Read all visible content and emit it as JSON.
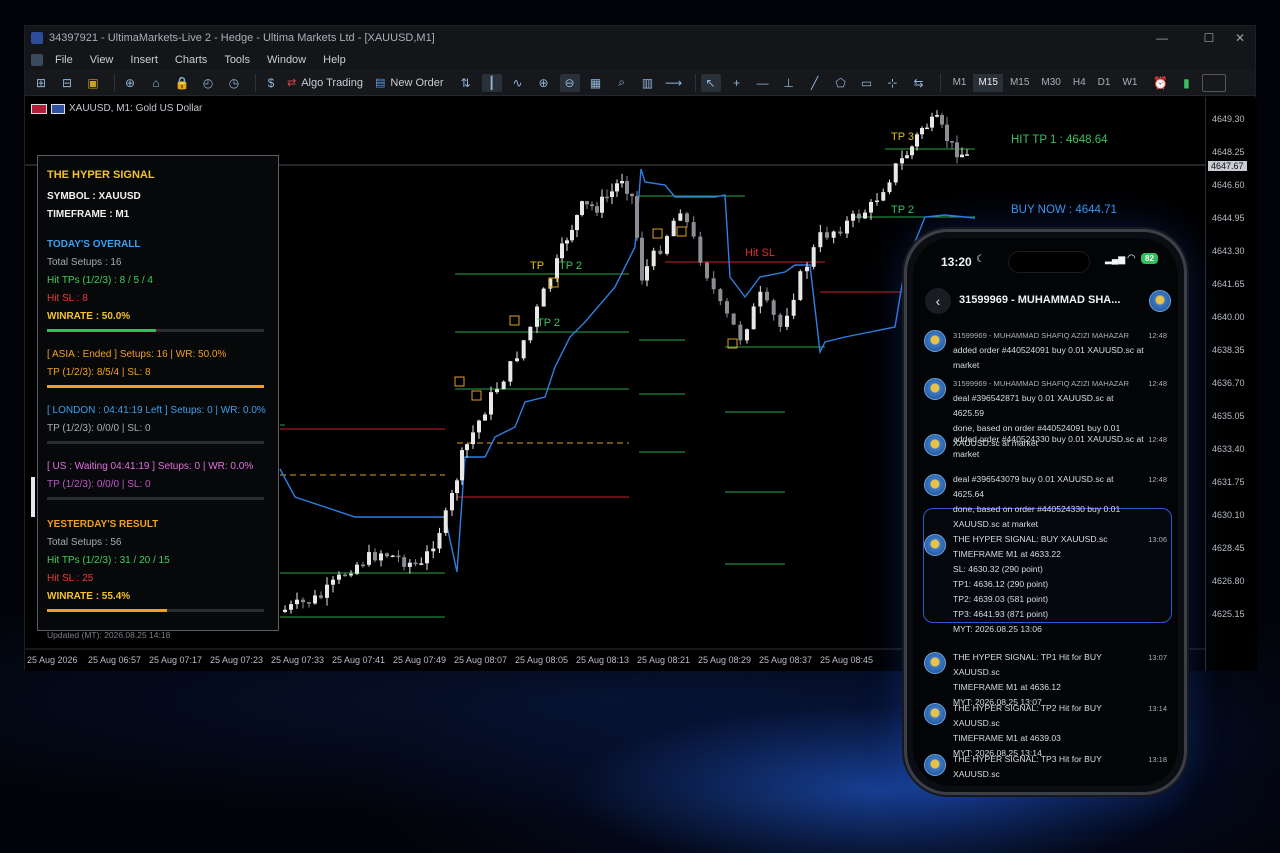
{
  "window": {
    "title": "34397921 - UltimaMarkets-Live 2 - Hedge - Ultima Markets Ltd - [XAUUSD,M1]",
    "controls": [
      "—",
      "☐",
      "✕"
    ]
  },
  "menu": [
    "File",
    "View",
    "Insert",
    "Charts",
    "Tools",
    "Window",
    "Help"
  ],
  "toolbar": {
    "algo_trading": "Algo Trading",
    "new_order": "New Order",
    "timeframes": [
      "M1",
      "M15",
      "M15",
      "M30",
      "H4",
      "D1",
      "W1"
    ],
    "selected_timeframe": "M15"
  },
  "chart": {
    "symbol_label": "XAUUSD, M1: Gold US Dollar",
    "price_ticks": [
      "4649.30",
      "4648.25",
      "4646.60",
      "4644.95",
      "4643.30",
      "4641.65",
      "4640.00",
      "4638.35",
      "4636.70",
      "4635.05",
      "4633.40",
      "4631.75",
      "4630.10",
      "4628.45",
      "4626.80",
      "4625.15"
    ],
    "current_price": "4647.67",
    "time_ticks": [
      "25 Aug 2026",
      "25 Aug 06:57",
      "25 Aug 07:17",
      "25 Aug 07:23",
      "25 Aug 07:33",
      "25 Aug 07:41",
      "25 Aug 07:49",
      "25 Aug 08:07",
      "25 Aug 08:05",
      "25 Aug 08:13",
      "25 Aug 08:21",
      "25 Aug 08:29",
      "25 Aug 08:37",
      "25 Aug 08:45"
    ],
    "labels": {
      "tp3": "TP 3",
      "tp2_a": "TP 2",
      "tp2_b": "TP 2",
      "tp2_c": "TP 2",
      "tp2_d": "TP 2",
      "tp_small": "TP",
      "hit_sl": "Hit SL",
      "hit_tp1": "HIT TP 1 : 4648.64",
      "buy_now": "BUY NOW : 4644.71"
    },
    "colors": {
      "bull": "#e8e8e8",
      "bear": "#8a8d92",
      "trend": "#2f7fe0",
      "tp_line": "#2aa64a",
      "sl_line": "#c8202a",
      "entry": "#e0a020"
    }
  },
  "signal_panel": {
    "title": "THE HYPER SIGNAL",
    "symbol": "SYMBOL : XAUUSD",
    "timeframe": "TIMEFRAME : M1",
    "today_header": "TODAY'S OVERALL",
    "today_setups": "Total Setups : 16",
    "today_tps": "Hit TPs (1/2/3) : 8 / 5 / 4",
    "today_sl": "Hit SL : 8",
    "today_winrate": "WINRATE : 50.0%",
    "today_winrate_value": 0.5,
    "asia_line": "[ ASIA : Ended ]  Setups: 16 | WR: 50.0%",
    "asia_tp": "TP (1/2/3): 8/5/4 | SL: 8",
    "asia_value": 0.5,
    "london_line": "[ LONDON : 04:41:19 Left ]  Setups: 0 | WR: 0.0%",
    "london_tp": "TP (1/2/3): 0/0/0 | SL: 0",
    "us_line": "[ US : Waiting 04:41:19 ]  Setups: 0 | WR: 0.0%",
    "us_tp": "TP (1/2/3): 0/0/0 | SL: 0",
    "yesterday_header": "YESTERDAY'S RESULT",
    "y_setups": "Total Setups : 56",
    "y_tps": "Hit TPs (1/2/3) : 31 / 20 / 15",
    "y_sl": "Hit SL : 25",
    "y_winrate": "WINRATE : 55.4%",
    "y_winrate_value": 0.554,
    "updated": "Updated (MT): 2026.08.25 14:18"
  },
  "phone": {
    "time": "13:20",
    "battery": "82",
    "chat_title": "31599969 - MUHAMMAD SHA...",
    "messages": [
      {
        "lines": [
          "31599969 - MUHAMMAD SHAFIQ AZIZI MAHAZAR",
          "added order #440524091 buy 0.01 XAUUSD.sc at",
          "market"
        ],
        "time": "12:48"
      },
      {
        "lines": [
          "31599969 - MUHAMMAD SHAFIQ AZIZI MAHAZAR",
          "deal #396542871 buy 0.01 XAUUSD.sc at 4625.59",
          "done, based on order #440524091 buy 0.01",
          "XAUUSD.sc at market"
        ],
        "time": "12:48"
      },
      {
        "lines": [
          "added order #440524330 buy 0.01 XAUUSD.sc at",
          "market"
        ],
        "time": "12:48"
      },
      {
        "lines": [
          "deal #396543079 buy 0.01 XAUUSD.sc at 4625.64",
          "done, based on order #440524330 buy 0.01",
          "XAUUSD.sc at market"
        ],
        "time": "12:48"
      },
      {
        "lines": [
          "THE HYPER SIGNAL: BUY XAUUSD.sc",
          "TIMEFRAME M1 at 4633.22",
          "SL: 4630.32 (290 point)",
          "TP1: 4636.12 (290 point)",
          "TP2: 4639.03 (581 point)",
          "TP3: 4641.93 (871 point)",
          "MYT: 2026.08.25 13:06"
        ],
        "time": "13:06"
      },
      {
        "lines": [
          "THE HYPER SIGNAL: TP1 Hit for BUY XAUUSD.sc",
          "TIMEFRAME M1 at 4636.12",
          "MYT: 2026.08.25 13:07"
        ],
        "time": "13:07"
      },
      {
        "lines": [
          "THE HYPER SIGNAL: TP2 Hit for BUY XAUUSD.sc",
          "TIMEFRAME M1 at 4639.03",
          "MYT: 2026.08.25 13:14"
        ],
        "time": "13:14"
      },
      {
        "lines": [
          "THE HYPER SIGNAL: TP3 Hit for BUY XAUUSD.sc",
          "TIMEFRAME M1 at 4641.93",
          "MYT: 2026.08.25 13:18"
        ],
        "time": "13:18"
      }
    ]
  }
}
